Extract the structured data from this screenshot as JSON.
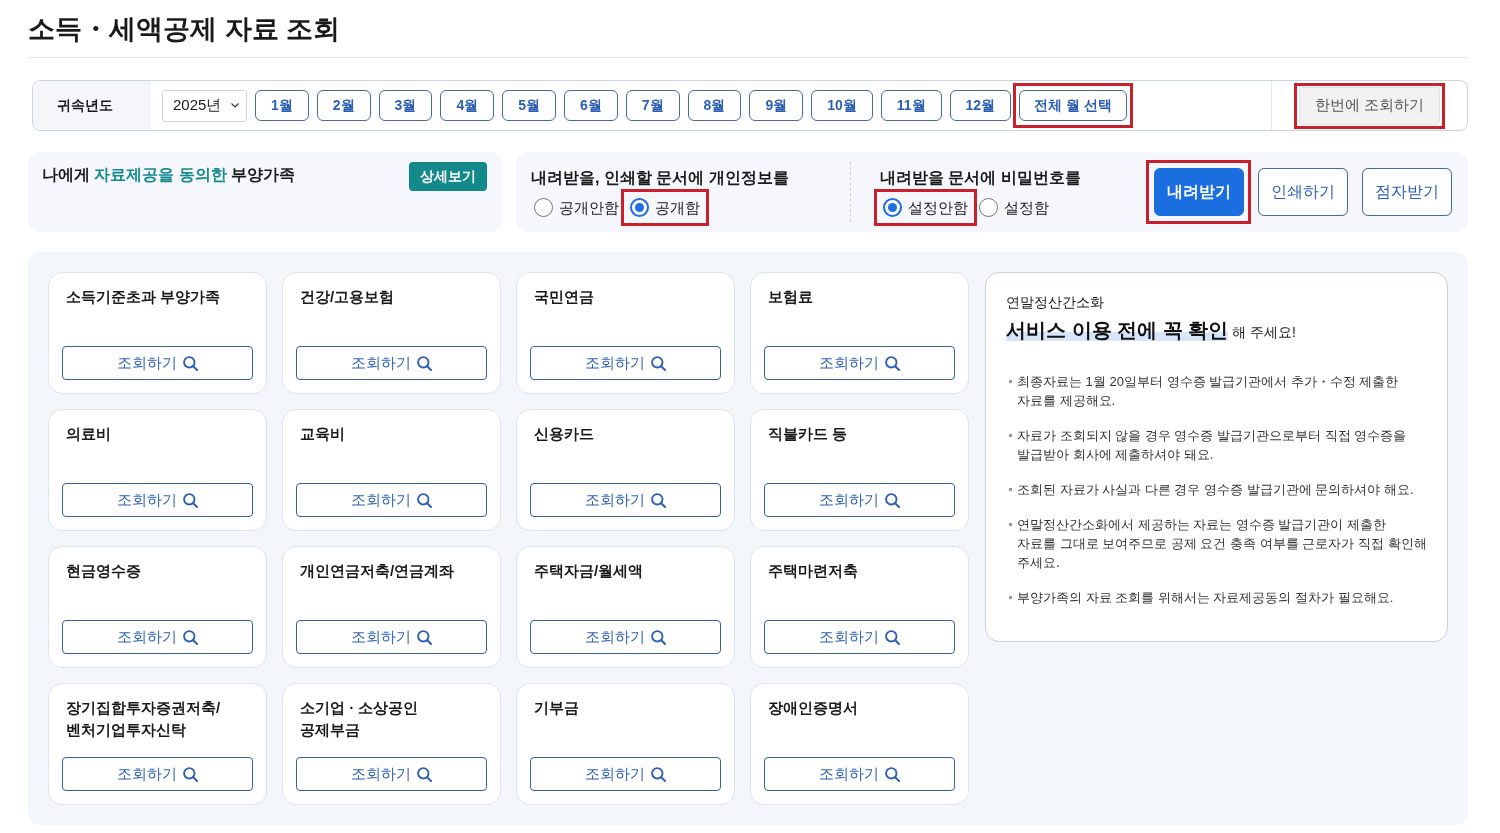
{
  "page_title": "소득・세액공제 자료 조회",
  "period_bar": {
    "label": "귀속년도",
    "year_select": {
      "value": "2025년"
    },
    "months": [
      {
        "label": "1월",
        "selected": false
      },
      {
        "label": "2월",
        "selected": false
      },
      {
        "label": "3월",
        "selected": false
      },
      {
        "label": "4월",
        "selected": false
      },
      {
        "label": "5월",
        "selected": false
      },
      {
        "label": "6월",
        "selected": false
      },
      {
        "label": "7월",
        "selected": false
      },
      {
        "label": "8월",
        "selected": false
      },
      {
        "label": "9월",
        "selected": false
      },
      {
        "label": "10월",
        "selected": false
      },
      {
        "label": "11월",
        "selected": false
      },
      {
        "label": "12월",
        "selected": false
      }
    ],
    "select_all_button": {
      "label": "전체 월 선택",
      "highlighted": true
    },
    "query_all_button": {
      "label": "한번에 조회하기",
      "disabled": true,
      "highlighted": true
    }
  },
  "dependents_panel": {
    "text": "나에게 **자료제공을 동의한** 부양가족",
    "detail_button": "상세보기"
  },
  "document_options": {
    "groups": [
      {
        "label": "내려받을, 인쇄할 문서에 개인정보를",
        "options": [
          {
            "label": "공개안함",
            "selected": false,
            "highlighted": false
          },
          {
            "label": "공개함",
            "selected": true,
            "highlighted": true
          }
        ]
      },
      {
        "label": "내려받을 문서에 비밀번호를",
        "options": [
          {
            "label": "설정안함",
            "selected": true,
            "highlighted": true
          },
          {
            "label": "설정함",
            "selected": false,
            "highlighted": false
          }
        ]
      }
    ],
    "actions": [
      {
        "label": "내려받기",
        "kind": "primary",
        "highlighted": true
      },
      {
        "label": "인쇄하기",
        "kind": "outline",
        "highlighted": false
      },
      {
        "label": "점자받기",
        "kind": "outline",
        "highlighted": false
      }
    ]
  },
  "categories": [
    {
      "title": "소득기준초과 부양가족",
      "button": "조회하기"
    },
    {
      "title": "건강/고용보험",
      "button": "조회하기"
    },
    {
      "title": "국민연금",
      "button": "조회하기"
    },
    {
      "title": "보험료",
      "button": "조회하기"
    },
    {
      "title": "의료비",
      "button": "조회하기"
    },
    {
      "title": "교육비",
      "button": "조회하기"
    },
    {
      "title": "신용카드",
      "button": "조회하기"
    },
    {
      "title": "직불카드 등",
      "button": "조회하기"
    },
    {
      "title": "현금영수증",
      "button": "조회하기"
    },
    {
      "title": "개인연금저축/연금계좌",
      "button": "조회하기"
    },
    {
      "title": "주택자금/월세액",
      "button": "조회하기"
    },
    {
      "title": "주택마련저축",
      "button": "조회하기"
    },
    {
      "title": "장기집합투자증권저축/\n벤처기업투자신탁",
      "button": "조회하기"
    },
    {
      "title": "소기업 · 소상공인\n공제부금",
      "button": "조회하기"
    },
    {
      "title": "기부금",
      "button": "조회하기"
    },
    {
      "title": "장애인증명서",
      "button": "조회하기"
    }
  ],
  "notice": {
    "subtitle": "연말정산간소화",
    "heading": "**서비스 이용 전에 꼭 확인** 해 주세요!",
    "items": [
      "최종자료는 1월 20일부터 영수증 발급기관에서 추가・수정 제출한 자료를 제공해요.",
      "자료가 조회되지 않을 경우 영수증 발급기관으로부터 직접 영수증을 발급받아 회사에 제출하셔야 돼요.",
      "조회된 자료가 사실과 다른 경우 영수증 발급기관에 문의하셔야 해요.",
      "연말정산간소화에서 제공하는 자료는 영수증 발급기관이 제출한 자료를 그대로 보여주므로 공제 요건 충족 여부를 근로자가 직접 확인해 주세요.",
      "부양가족의 자료 조회를 위해서는 자료제공동의 절차가 필요해요."
    ]
  }
}
